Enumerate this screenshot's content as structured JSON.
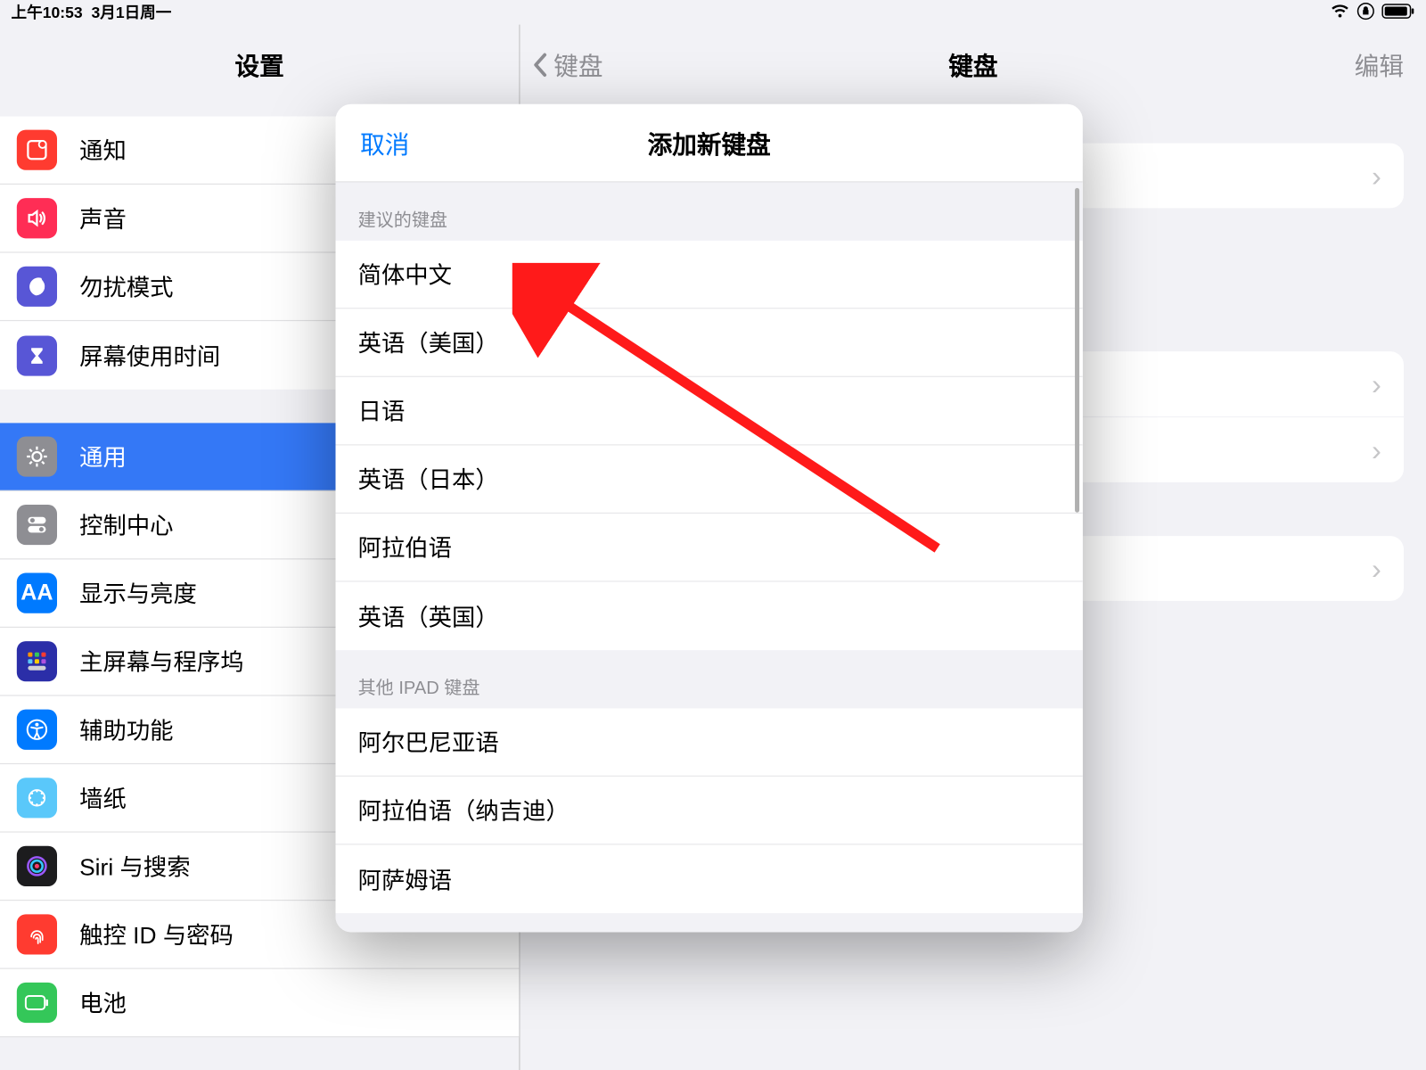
{
  "status": {
    "time": "上午10:53",
    "date": "3月1日周一"
  },
  "sidebar": {
    "title": "设置",
    "items": [
      {
        "label": "通知"
      },
      {
        "label": "声音"
      },
      {
        "label": "勿扰模式"
      },
      {
        "label": "屏幕使用时间"
      },
      {
        "label": "通用"
      },
      {
        "label": "控制中心"
      },
      {
        "label": "显示与亮度"
      },
      {
        "label": "主屏幕与程序坞"
      },
      {
        "label": "辅助功能"
      },
      {
        "label": "墙纸"
      },
      {
        "label": "Siri 与搜索"
      },
      {
        "label": "触控 ID 与密码"
      },
      {
        "label": "电池"
      }
    ]
  },
  "detail": {
    "back_label": "键盘",
    "title": "键盘",
    "edit_label": "编辑"
  },
  "modal": {
    "cancel": "取消",
    "title": "添加新键盘",
    "section_suggested": "建议的键盘",
    "suggested": [
      "简体中文",
      "英语（美国）",
      "日语",
      "英语（日本）",
      "阿拉伯语",
      "英语（英国）"
    ],
    "section_other": "其他 IPAD 键盘",
    "other": [
      "阿尔巴尼亚语",
      "阿拉伯语（纳吉迪）",
      "阿萨姆语"
    ]
  }
}
